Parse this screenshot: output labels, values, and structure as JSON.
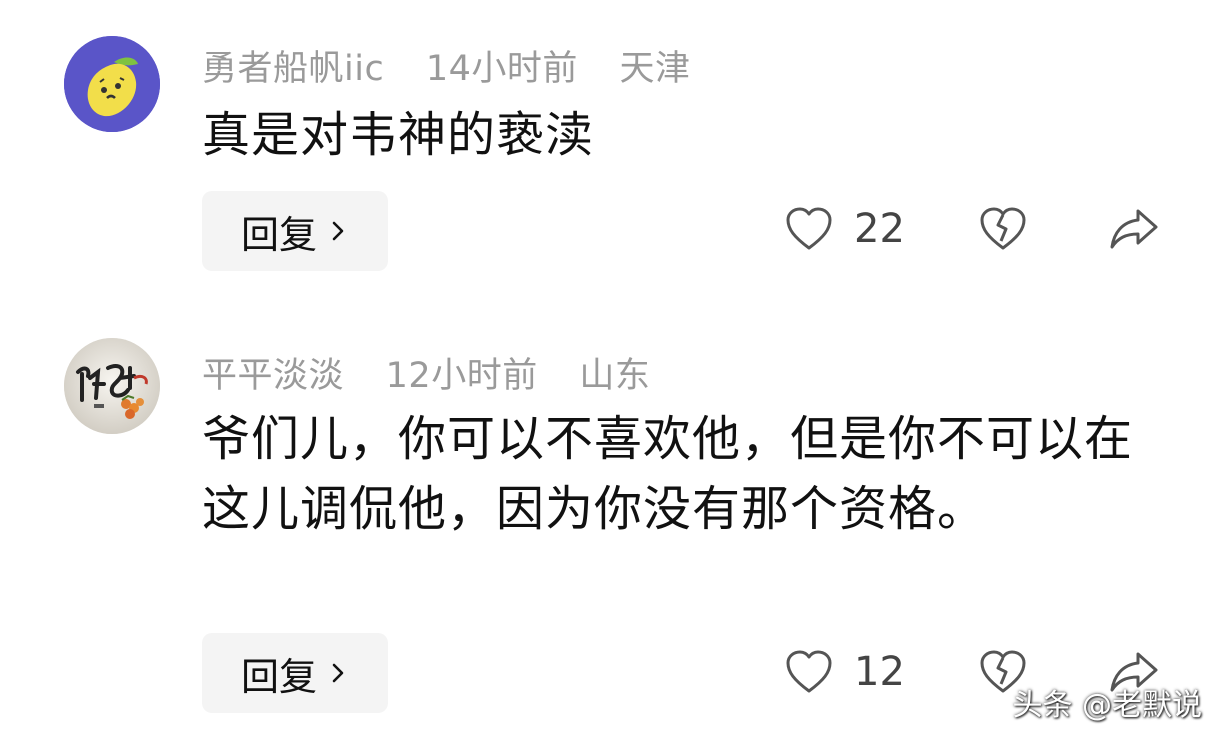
{
  "comments": [
    {
      "username": "勇者船帆iic",
      "time": "14小时前",
      "location": "天津",
      "text": "真是对韦神的亵渎",
      "reply_label": "回复",
      "likes": "22"
    },
    {
      "username": "平平淡淡",
      "time": "12小时前",
      "location": "山东",
      "text": "爷们儿，你可以不喜欢他，但是你不可以在这儿调侃他，因为你没有那个资格。",
      "reply_label": "回复",
      "likes": "12"
    }
  ],
  "watermark": "头条 @老默说",
  "colors": {
    "meta_text": "#9a9a9a",
    "reply_bg": "#f4f4f4",
    "avatar1_bg": "#5a55c8",
    "avatar1_fruit": "#f2de4a"
  },
  "icons": [
    "lemon-avatar",
    "calligraphy-avatar",
    "chevron-right-icon",
    "heart-icon",
    "broken-heart-icon",
    "share-icon"
  ]
}
